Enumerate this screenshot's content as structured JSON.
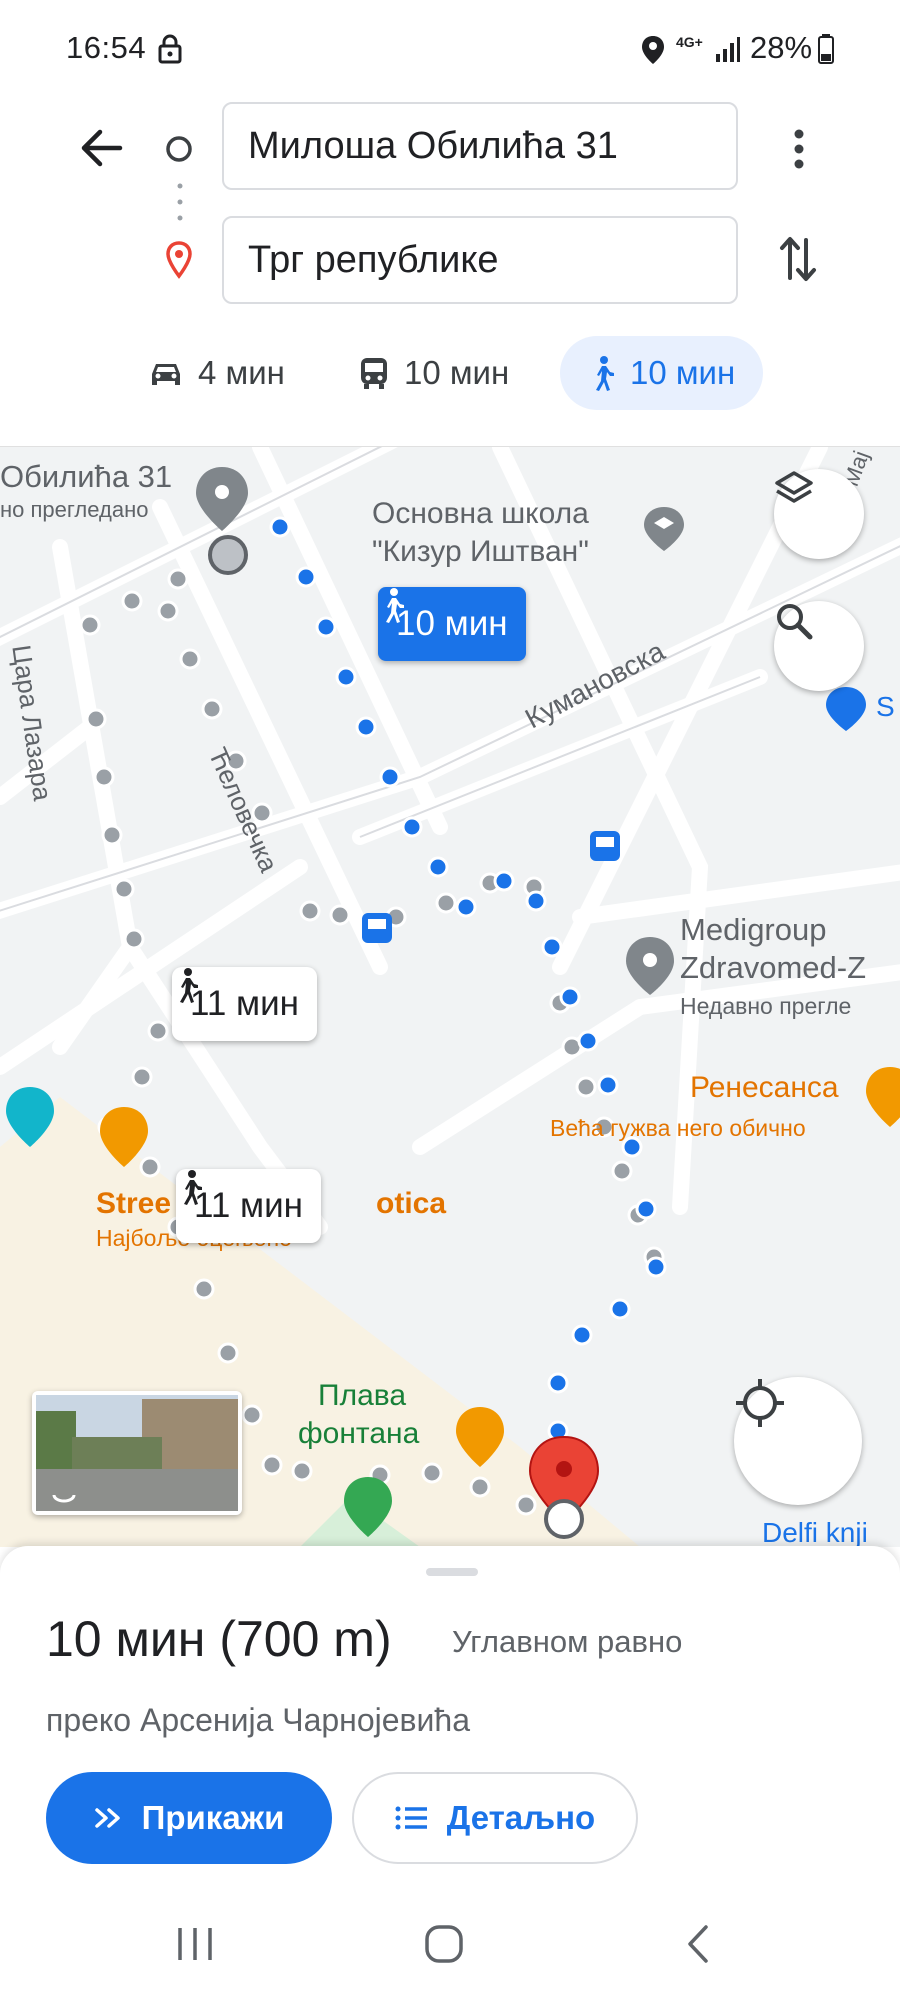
{
  "status": {
    "time": "16:54",
    "network": "4G+",
    "battery": "28%",
    "icons": [
      "lock-icon",
      "location-icon",
      "signal-icon",
      "battery-icon"
    ]
  },
  "directions": {
    "origin": "Милоша Обилића 31",
    "destination": "Трг републике",
    "modes": [
      {
        "name": "car",
        "icon": "car-icon",
        "label": "4 мин"
      },
      {
        "name": "transit",
        "icon": "bus-icon",
        "label": "10 мин"
      },
      {
        "name": "walk",
        "icon": "walking-icon",
        "label": "10 мин",
        "selected": true
      }
    ]
  },
  "map": {
    "origin_label": "Обилића 31",
    "origin_sublabel": "но прегледано",
    "school_label_1": "Основна школа",
    "school_label_2": "\"Кизур Иштван\"",
    "street_kumanovska": "Кумановска",
    "street_cara_lazara": "Цара Лазара",
    "street_celovecka": "Ћеловечка",
    "street_top_right": "Мај",
    "medigroup_1": "Medigroup",
    "medigroup_2": "Zdravomed-Z",
    "medigroup_sub": "Недавно прегле",
    "renesansa": "Ренесанса",
    "renesansa_sub": "Већа гужва него обично",
    "street_food_left": "Stree",
    "street_food_right": "otica",
    "street_food_sub": "Најбоље оцењено",
    "plava_1": "Плава",
    "plava_2": "фонтана",
    "delfi": "Delfi knji",
    "shop_partial": "S",
    "route_main_time": "10 мин",
    "route_alt1_time": "11 мин",
    "route_alt2_time": "11 мин"
  },
  "summary": {
    "duration": "10 мин",
    "distance": "(700 m)",
    "terrain": "Углавном равно",
    "via": "преко Арсенија Чарнојевића",
    "show_button": "Прикажи",
    "details_button": "Детаљно"
  },
  "colors": {
    "route_blue": "#1a73e8",
    "route_gray": "#9aa0a6",
    "accent": "#1a73e8",
    "poi_orange": "#f29900",
    "poi_green": "#188038",
    "pin_red": "#ea4335"
  }
}
